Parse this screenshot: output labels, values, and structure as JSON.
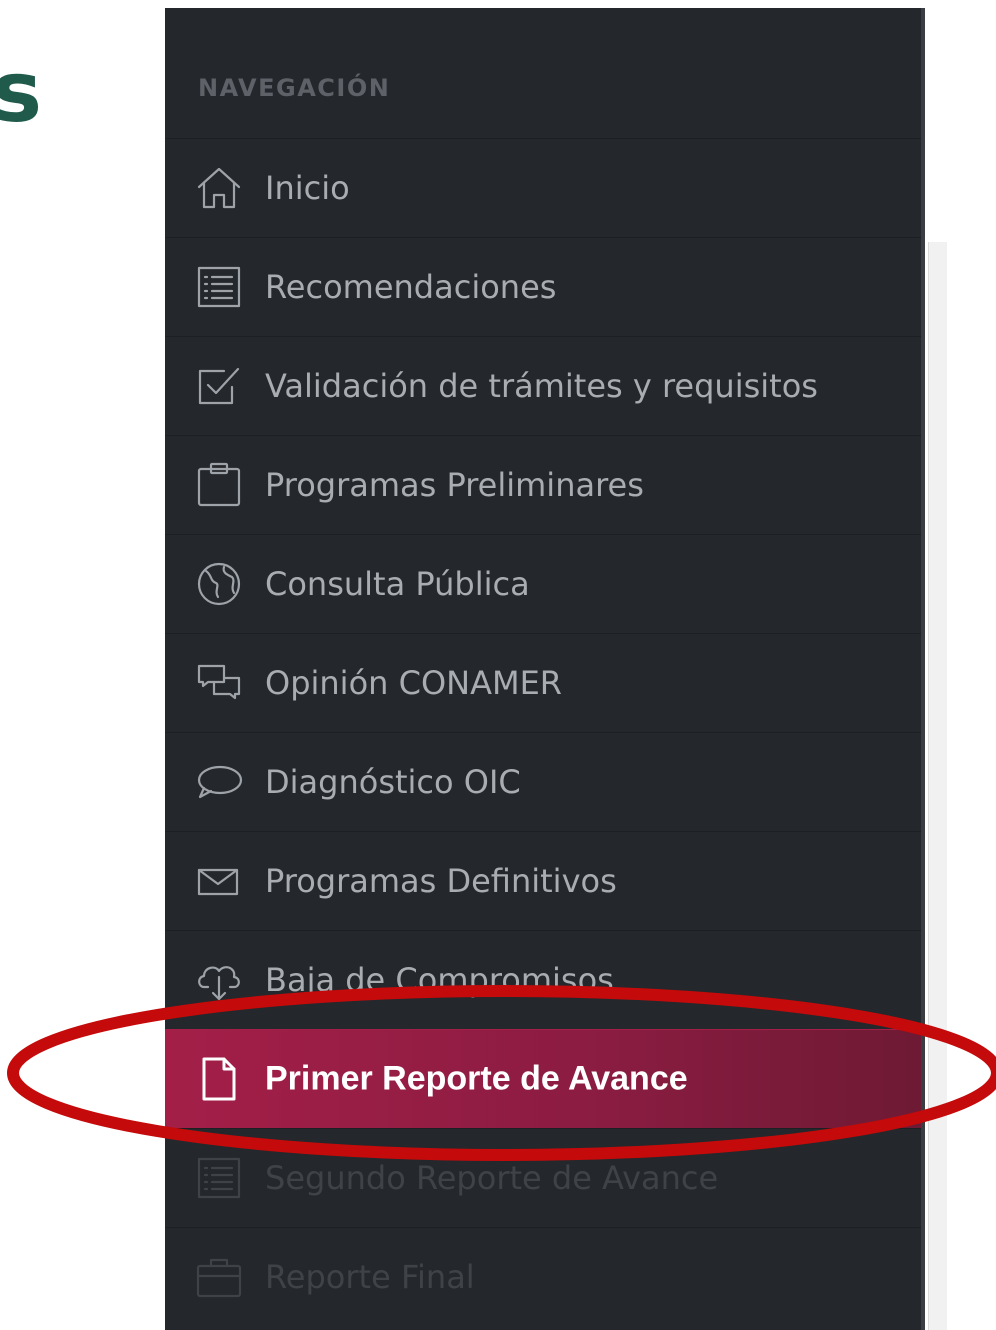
{
  "background": {
    "heading_fragment": "s"
  },
  "sidebar": {
    "section_title": "NAVEGACIÓN",
    "items": [
      {
        "label": "Inicio",
        "icon": "home-icon"
      },
      {
        "label": "Recomendaciones",
        "icon": "list-icon"
      },
      {
        "label": "Validación de trámites y requisitos",
        "icon": "checkbox-icon"
      },
      {
        "label": "Programas Preliminares",
        "icon": "clipboard-icon"
      },
      {
        "label": "Consulta Pública",
        "icon": "globe-icon"
      },
      {
        "label": "Opinión CONAMER",
        "icon": "chat-boxes-icon"
      },
      {
        "label": "Diagnóstico OIC",
        "icon": "speech-bubble-icon"
      },
      {
        "label": "Programas Definitivos",
        "icon": "envelope-icon"
      },
      {
        "label": "Baja de Compromisos",
        "icon": "cloud-download-icon"
      },
      {
        "label": "Primer Reporte de Avance",
        "icon": "document-icon",
        "active": true
      },
      {
        "label": "Segundo Reporte de Avance",
        "icon": "list-icon"
      },
      {
        "label": "Reporte Final",
        "icon": "briefcase-icon"
      }
    ]
  },
  "colors": {
    "sidebar_bg": "#24272b",
    "active_bg": "#a31f48",
    "annotation_ring": "#c40a0a",
    "heading_green": "#1f5a4a"
  }
}
